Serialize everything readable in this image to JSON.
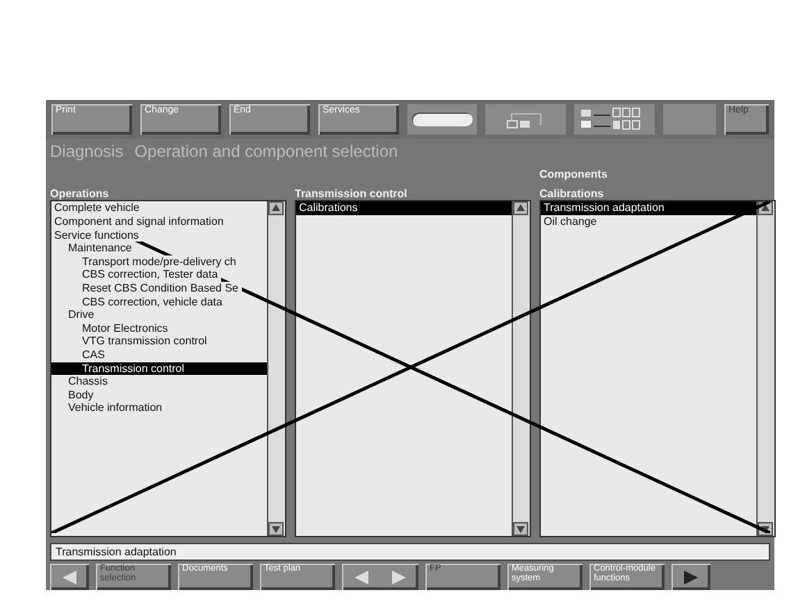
{
  "toolbar": {
    "buttons": [
      {
        "label": "Print",
        "disabled": false
      },
      {
        "label": "Change",
        "disabled": false
      },
      {
        "label": "End",
        "disabled": false
      },
      {
        "label": "Services",
        "disabled": false
      }
    ],
    "help": {
      "label": "Help",
      "disabled": true
    }
  },
  "title": {
    "area": "Diagnosis",
    "heading": "Operation and component selection"
  },
  "columns": [
    {
      "header": "Operations",
      "items": [
        {
          "label": "Complete vehicle",
          "selected": false
        },
        {
          "label": "Component and signal information",
          "selected": false
        },
        {
          "label": "Service functions",
          "selected": false,
          "children": [
            {
              "label": "Maintenance",
              "selected": false,
              "children": [
                {
                  "label": "Transport mode/pre-delivery ch",
                  "selected": false
                },
                {
                  "label": "CBS correction, Tester data",
                  "selected": false
                },
                {
                  "label": "Reset CBS Condition Based Se",
                  "selected": false
                },
                {
                  "label": "CBS correction, vehicle data",
                  "selected": false
                }
              ]
            },
            {
              "label": "Drive",
              "selected": false,
              "children": [
                {
                  "label": "Motor Electronics",
                  "selected": false
                },
                {
                  "label": "VTG transmission control",
                  "selected": false
                },
                {
                  "label": "CAS",
                  "selected": false
                },
                {
                  "label": "Transmission control",
                  "selected": true
                }
              ]
            },
            {
              "label": "Chassis",
              "selected": false
            },
            {
              "label": "Body",
              "selected": false
            },
            {
              "label": "Vehicle information",
              "selected": false
            }
          ]
        }
      ]
    },
    {
      "header": "Transmission control",
      "items": [
        {
          "label": "Calibrations",
          "selected": true
        }
      ]
    },
    {
      "supheader": "Components",
      "header": "Calibrations",
      "items": [
        {
          "label": "Transmission adaptation",
          "selected": true
        },
        {
          "label": "Oil change",
          "selected": false
        }
      ]
    }
  ],
  "status": {
    "value": "Transmission adaptation"
  },
  "bottom_bar": [
    {
      "kind": "arrow-left",
      "disabled": false
    },
    {
      "kind": "text",
      "label": "Function selection",
      "disabled": true
    },
    {
      "kind": "text",
      "label": "Documents",
      "disabled": false
    },
    {
      "kind": "text",
      "label": "Test plan",
      "disabled": false
    },
    {
      "kind": "arrows",
      "disabled": false
    },
    {
      "kind": "text",
      "label": "FP",
      "disabled": true
    },
    {
      "kind": "text",
      "label": "Measuring system",
      "disabled": false
    },
    {
      "kind": "text",
      "label": "Control-module functions",
      "disabled": false
    },
    {
      "kind": "arrow-right",
      "disabled": false
    }
  ]
}
